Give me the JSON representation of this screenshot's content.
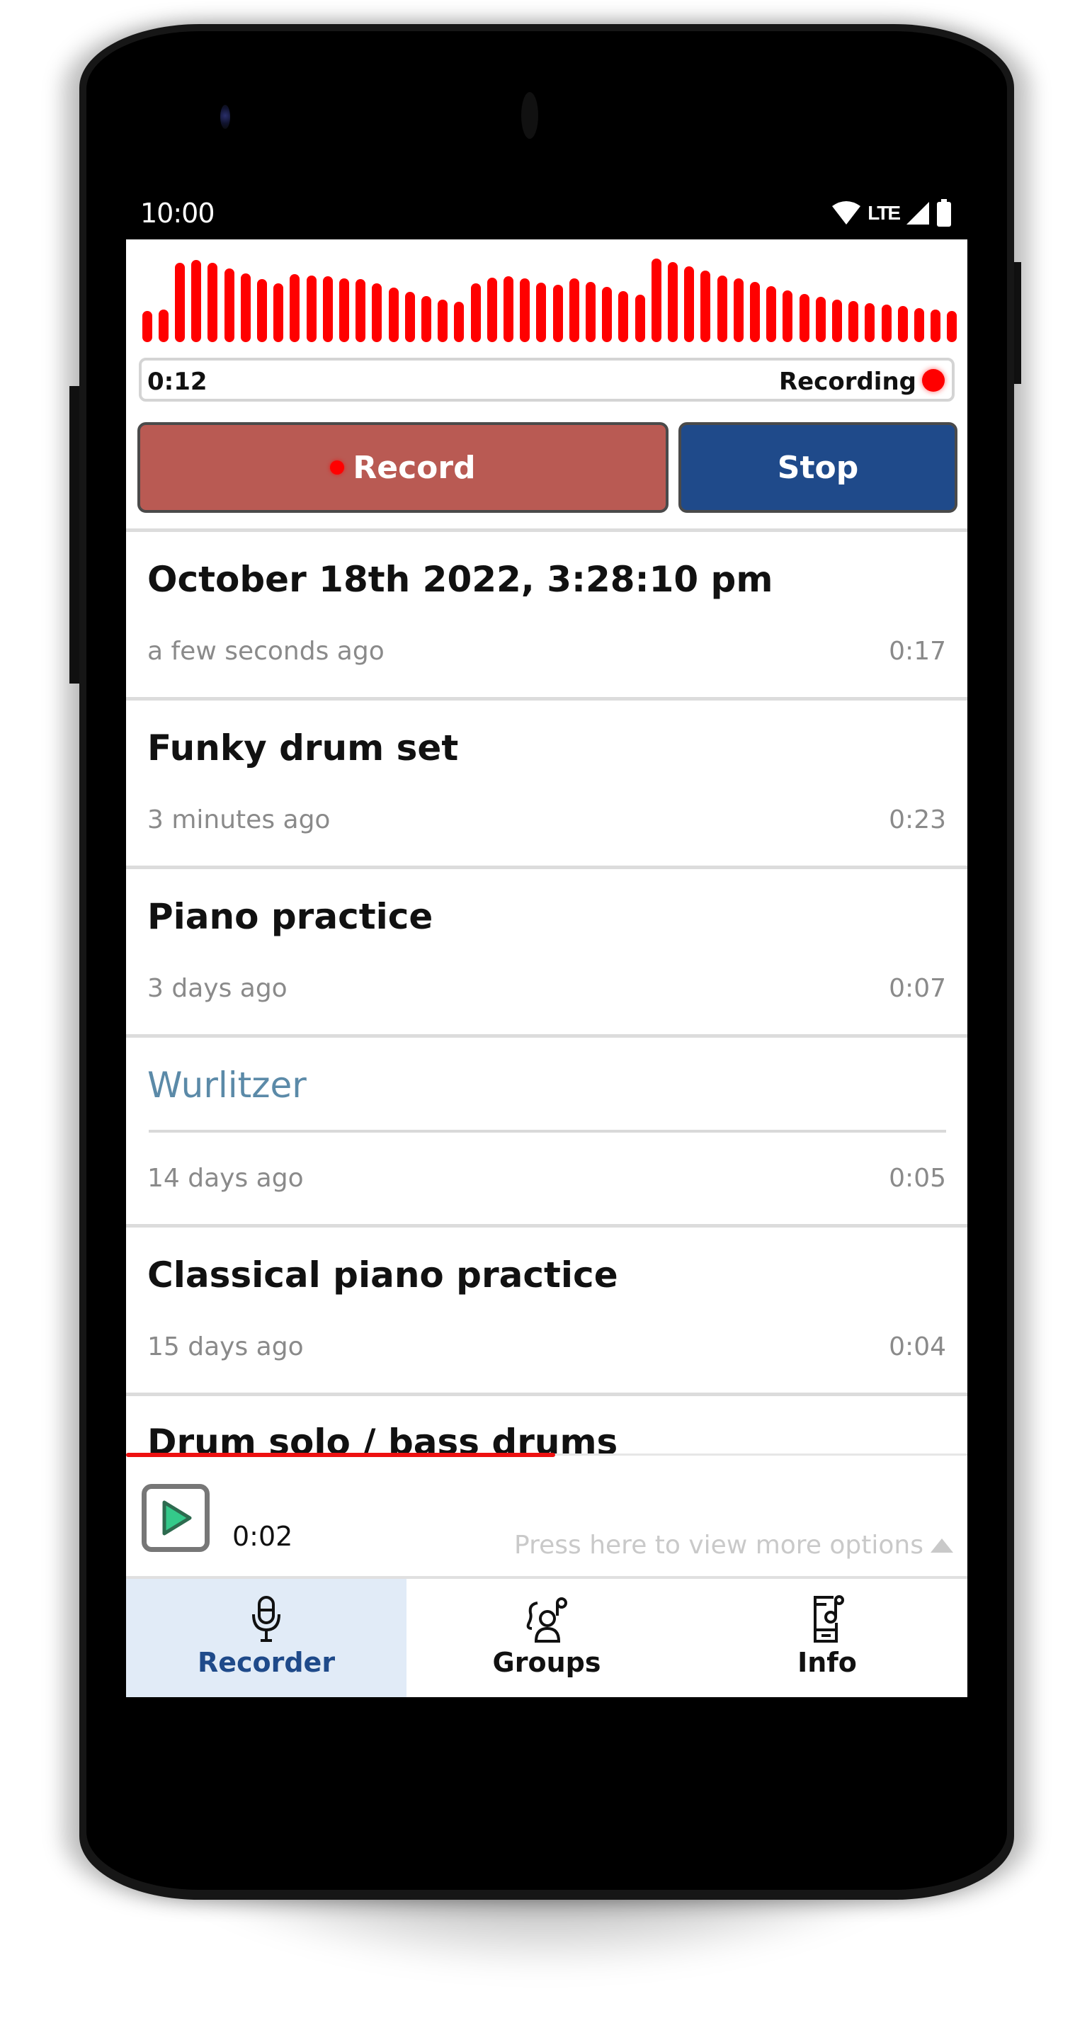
{
  "status_bar": {
    "time": "10:00",
    "network_label": "LTE",
    "icons": [
      "wifi-icon",
      "cell-signal-icon",
      "battery-icon"
    ]
  },
  "recorder": {
    "waveform_amplitudes": [
      0.37,
      0.39,
      0.95,
      0.98,
      0.95,
      0.88,
      0.82,
      0.75,
      0.7,
      0.81,
      0.8,
      0.79,
      0.76,
      0.75,
      0.7,
      0.65,
      0.6,
      0.55,
      0.51,
      0.48,
      0.7,
      0.77,
      0.79,
      0.76,
      0.71,
      0.69,
      0.76,
      0.72,
      0.66,
      0.61,
      0.57,
      1.0,
      0.96,
      0.91,
      0.86,
      0.8,
      0.76,
      0.72,
      0.67,
      0.62,
      0.58,
      0.54,
      0.51,
      0.49,
      0.47,
      0.45,
      0.43,
      0.41,
      0.39,
      0.37
    ],
    "elapsed": "0:12",
    "status_label": "Recording",
    "record_label": "Record",
    "stop_label": "Stop",
    "colors": {
      "waveform": "#ff0000",
      "record_button": "#b95a53",
      "stop_button": "#1f4a8a"
    }
  },
  "recordings": [
    {
      "title": "October 18th 2022, 3:28:10 pm",
      "when": "a few seconds ago",
      "duration": "0:17",
      "editing": false
    },
    {
      "title": "Funky drum set",
      "when": "3 minutes ago",
      "duration": "0:23",
      "editing": false
    },
    {
      "title": "Piano practice",
      "when": "3 days ago",
      "duration": "0:07",
      "editing": false
    },
    {
      "title": "Wurlitzer",
      "when": "14 days ago",
      "duration": "0:05",
      "editing": true
    },
    {
      "title": "Classical piano practice",
      "when": "15 days ago",
      "duration": "0:04",
      "editing": false
    },
    {
      "title": "Drum solo / bass drums",
      "when": "",
      "duration": "",
      "editing": false
    }
  ],
  "player": {
    "position": "0:02",
    "progress_fraction": 0.51,
    "more_options_label": "Press here to view more options"
  },
  "tabs": [
    {
      "label": "Recorder",
      "icon": "microphone-icon",
      "active": true
    },
    {
      "label": "Groups",
      "icon": "groups-icon",
      "active": false
    },
    {
      "label": "Info",
      "icon": "info-phone-icon",
      "active": false
    }
  ]
}
